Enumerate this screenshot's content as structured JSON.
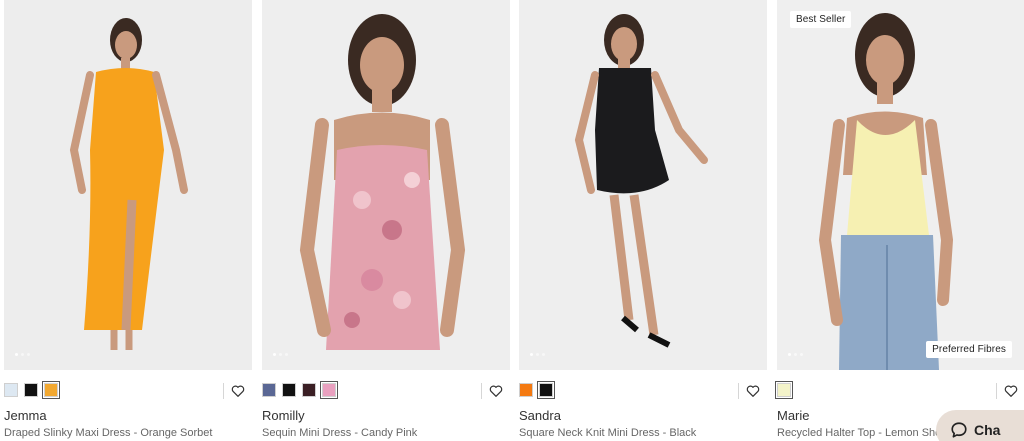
{
  "products": [
    {
      "name": "Jemma",
      "description": "Draped Slinky Maxi Dress - Orange Sorbet",
      "badge_top": "",
      "badge_bottom": "",
      "swatches": [
        "#dde8f2",
        "#111111",
        "#f2a830"
      ],
      "selected_swatch": 2,
      "garment_color": "#f7a21c",
      "backdrop": "#ededed"
    },
    {
      "name": "Romilly",
      "description": "Sequin Mini Dress - Candy Pink",
      "badge_top": "",
      "badge_bottom": "",
      "swatches": [
        "#5a6794",
        "#111111",
        "#3a1f24",
        "#e9a0bf"
      ],
      "selected_swatch": 3,
      "garment_color": "#e3a2ae",
      "backdrop": "#eeeeee"
    },
    {
      "name": "Sandra",
      "description": "Square Neck Knit Mini Dress - Black",
      "badge_top": "",
      "badge_bottom": "",
      "swatches": [
        "#f47a12",
        "#111111"
      ],
      "selected_swatch": 1,
      "garment_color": "#1b1b1d",
      "backdrop": "#eeeeee"
    },
    {
      "name": "Marie",
      "description": "Recycled Halter Top - Lemon Sherbet",
      "badge_top": "Best Seller",
      "badge_bottom": "Preferred Fibres",
      "swatches": [
        "#f3f3c9"
      ],
      "selected_swatch": 0,
      "garment_color": "#f6f0b2",
      "backdrop": "#efefef"
    }
  ],
  "chat": {
    "label": "Cha",
    "icon": "chat-bubble-icon"
  },
  "icons": {
    "wishlist": "heart-outline-icon"
  }
}
